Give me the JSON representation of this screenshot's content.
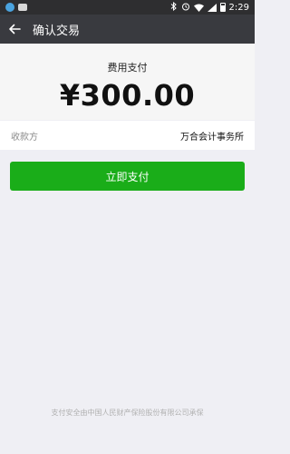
{
  "status_bar": {
    "time": "2:29",
    "icons": [
      "app-icon",
      "notification-icon",
      "bluetooth-icon",
      "alarm-icon",
      "wifi-icon",
      "signal-icon",
      "battery-icon"
    ]
  },
  "toolbar": {
    "title": "确认交易",
    "back_icon": "arrow-left-icon"
  },
  "payment": {
    "fee_label": "费用支付",
    "amount": "¥300.00"
  },
  "payee": {
    "label": "收款方",
    "value": "万合会计事务所"
  },
  "actions": {
    "pay_label": "立即支付"
  },
  "footer": {
    "note": "支付安全由中国人民财产保险股份有限公司承保"
  },
  "colors": {
    "toolbar": "#393a3f",
    "status_bar": "#2e2e30",
    "accent": "#1aad19",
    "background": "#efeff4"
  }
}
